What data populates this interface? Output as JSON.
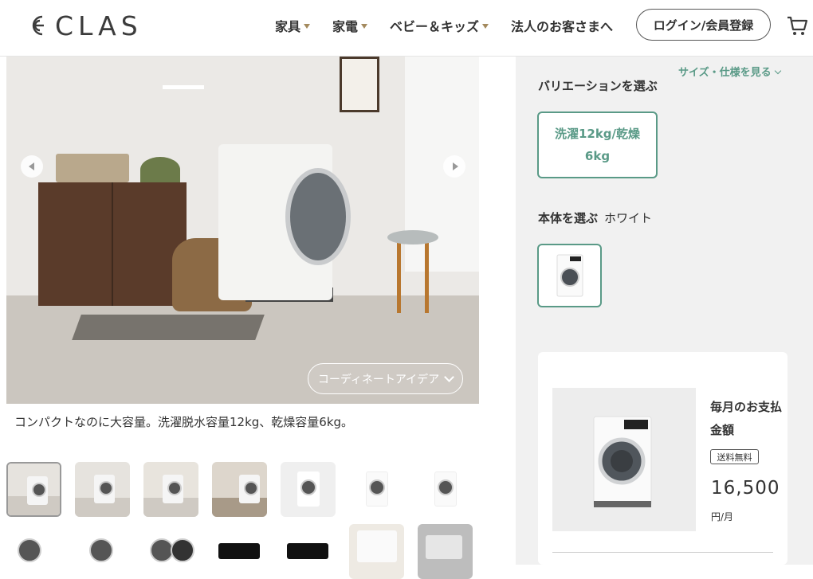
{
  "header": {
    "logo_text": "CLAS",
    "nav": [
      {
        "label": "家具",
        "has_caret": true
      },
      {
        "label": "家電",
        "has_caret": true
      },
      {
        "label": "ベビー＆キッズ",
        "has_caret": true
      },
      {
        "label": "法人のお客さまへ",
        "has_caret": false
      }
    ],
    "login_label": "ログイン/会員登録",
    "cart_icon": "cart-icon",
    "accent_caret_color": "#a48a5e"
  },
  "gallery": {
    "coordinate_button": "コーディネートアイデア",
    "caption": "コンパクトなのに大容量。洗濯脱水容量12kg、乾燥容量6kg。",
    "thumbnail_count": 14
  },
  "options": {
    "size_link": "サイズ・仕様を見る",
    "variation_label": "バリエーションを選ぶ",
    "variation_value_line1": "洗濯12kg/乾燥",
    "variation_value_line2": "6kg",
    "body_label": "本体を選ぶ",
    "body_value": "ホワイト",
    "accent_color": "#5a9a87"
  },
  "price_card": {
    "title": "毎月のお支払金額",
    "free_shipping": "送料無料",
    "price": "16,500",
    "unit": "円/月"
  }
}
